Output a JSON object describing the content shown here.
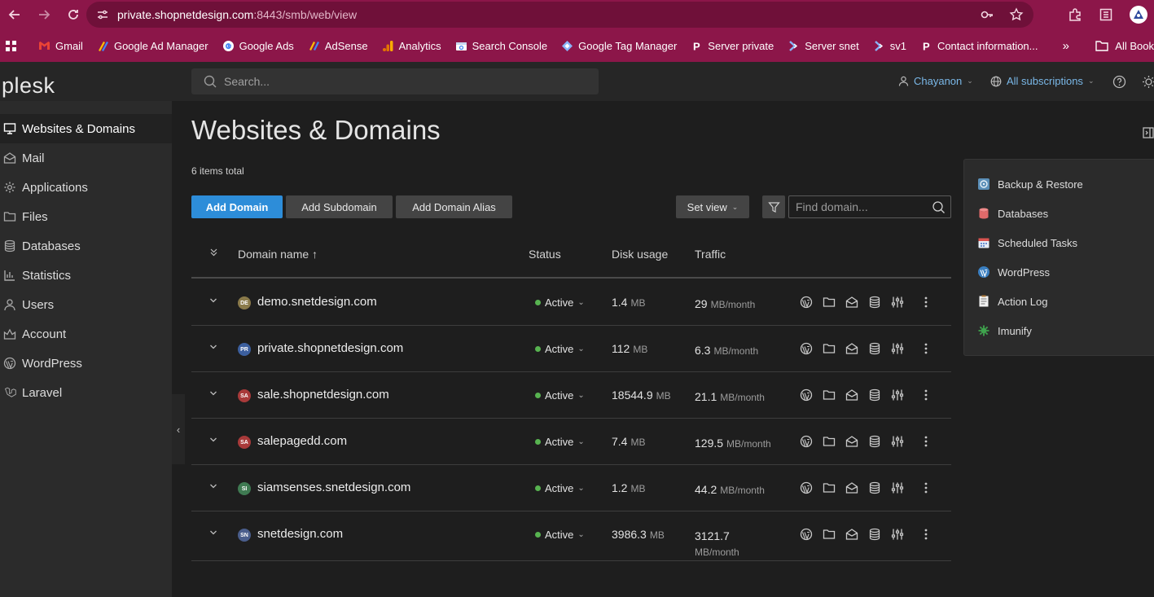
{
  "browser": {
    "url_host": "private.shopnetdesign.com",
    "url_rest": ":8443/smb/web/view",
    "bookmarks": [
      {
        "label": "Gmail",
        "icon": "gmail-icon",
        "color": "#ea4335"
      },
      {
        "label": "Google Ad Manager",
        "icon": "ad-manager-icon",
        "color": "#fbbc04"
      },
      {
        "label": "Google Ads",
        "icon": "google-ads-icon",
        "color": "#ffffff"
      },
      {
        "label": "AdSense",
        "icon": "adsense-icon",
        "color": "#fbbc04"
      },
      {
        "label": "Analytics",
        "icon": "analytics-icon",
        "color": "#f9ab00"
      },
      {
        "label": "Search Console",
        "icon": "search-console-icon",
        "color": "#ffffff"
      },
      {
        "label": "Google Tag Manager",
        "icon": "tag-manager-icon",
        "color": "#8ab4f8"
      },
      {
        "label": "Server private",
        "icon": "plesk-p-icon",
        "color": "#5a6b9a"
      },
      {
        "label": "Server snet",
        "icon": "chevron-arrow-icon",
        "color": "#8ab4f8"
      },
      {
        "label": "sv1",
        "icon": "chevron-arrow-icon",
        "color": "#8ab4f8"
      },
      {
        "label": "Contact information...",
        "icon": "plesk-p-icon",
        "color": "#5a6b9a"
      }
    ],
    "all_bookmarks": "All Book"
  },
  "header": {
    "logo": "plesk",
    "search_placeholder": "Search...",
    "user": "Chayanon",
    "subscriptions": "All subscriptions"
  },
  "sidebar": {
    "items": [
      {
        "label": "Websites & Domains",
        "icon": "monitor-icon",
        "active": true
      },
      {
        "label": "Mail",
        "icon": "mail-icon",
        "active": false
      },
      {
        "label": "Applications",
        "icon": "gear-icon",
        "active": false
      },
      {
        "label": "Files",
        "icon": "folder-icon",
        "active": false
      },
      {
        "label": "Databases",
        "icon": "database-icon",
        "active": false
      },
      {
        "label": "Statistics",
        "icon": "bar-chart-icon",
        "active": false
      },
      {
        "label": "Users",
        "icon": "user-icon",
        "active": false
      },
      {
        "label": "Account",
        "icon": "account-icon",
        "active": false
      },
      {
        "label": "WordPress",
        "icon": "wordpress-icon",
        "active": false
      },
      {
        "label": "Laravel",
        "icon": "laravel-icon",
        "active": false
      }
    ]
  },
  "main": {
    "title": "Websites & Domains",
    "items_total": "6 items total",
    "buttons": {
      "add_domain": "Add Domain",
      "add_subdomain": "Add Subdomain",
      "add_alias": "Add Domain Alias",
      "set_view": "Set view"
    },
    "find_placeholder": "Find domain...",
    "columns": {
      "domain": "Domain name ↑",
      "status": "Status",
      "disk": "Disk usage",
      "traffic": "Traffic"
    },
    "domains": [
      {
        "badge": "DE",
        "badge_color": "#8a7a4a",
        "name": "demo.snetdesign.com",
        "status": "Active",
        "disk_value": "1.4",
        "disk_unit": "MB",
        "traffic_value": "29",
        "traffic_unit": "MB/month"
      },
      {
        "badge": "PR",
        "badge_color": "#3c5f9e",
        "name": "private.shopnetdesign.com",
        "status": "Active",
        "disk_value": "112",
        "disk_unit": "MB",
        "traffic_value": "6.3",
        "traffic_unit": "MB/month"
      },
      {
        "badge": "SA",
        "badge_color": "#a83a3a",
        "name": "sale.shopnetdesign.com",
        "status": "Active",
        "disk_value": "18544.9",
        "disk_unit": "MB",
        "traffic_value": "21.1",
        "traffic_unit": "MB/month"
      },
      {
        "badge": "SA",
        "badge_color": "#a83a3a",
        "name": "salepagedd.com",
        "status": "Active",
        "disk_value": "7.4",
        "disk_unit": "MB",
        "traffic_value": "129.5",
        "traffic_unit": "MB/month"
      },
      {
        "badge": "SI",
        "badge_color": "#3f7a52",
        "name": "siamsenses.snetdesign.com",
        "status": "Active",
        "disk_value": "1.2",
        "disk_unit": "MB",
        "traffic_value": "44.2",
        "traffic_unit": "MB/month"
      },
      {
        "badge": "SN",
        "badge_color": "#4a5e8c",
        "name": "snetdesign.com",
        "status": "Active",
        "disk_value": "3986.3",
        "disk_unit": "MB",
        "traffic_value": "3121.7",
        "traffic_unit": "MB/month"
      }
    ]
  },
  "right_panel": {
    "items": [
      {
        "label": "Backup & Restore",
        "icon": "backup-icon",
        "color": "#5b8fb8"
      },
      {
        "label": "Databases",
        "icon": "database-icon",
        "color": "#e06a6a"
      },
      {
        "label": "Scheduled Tasks",
        "icon": "calendar-icon",
        "color": "#6a8fd0"
      },
      {
        "label": "WordPress",
        "icon": "wordpress-icon",
        "color": "#3a7fc1"
      },
      {
        "label": "Action Log",
        "icon": "log-icon",
        "color": "#c9c9c9"
      },
      {
        "label": "Imunify",
        "icon": "imunify-icon",
        "color": "#3fa34d"
      }
    ]
  },
  "colors": {
    "chrome": "#8c1649",
    "accent": "#2d8dd9",
    "status_active": "#57b350",
    "link": "#7ab8e8"
  }
}
